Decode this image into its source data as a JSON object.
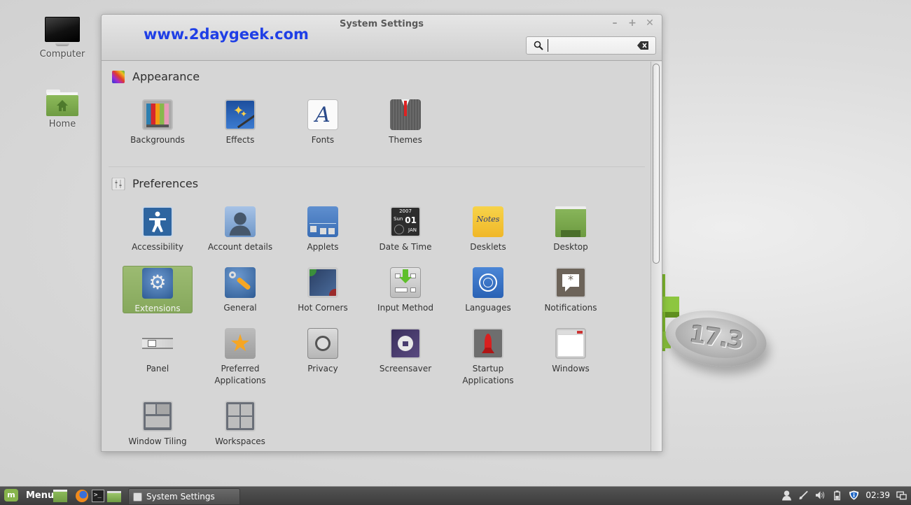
{
  "desktop": {
    "icons": [
      {
        "label": "Computer",
        "icon": "computer-icon"
      },
      {
        "label": "Home",
        "icon": "home-folder-icon"
      }
    ],
    "wallpaper_badge": "17.3"
  },
  "window": {
    "title": "System Settings",
    "watermark": "www.2daygeek.com",
    "controls": {
      "minimize": "–",
      "maximize": "+",
      "close": "✕"
    },
    "search": {
      "value": "",
      "placeholder": ""
    }
  },
  "sections": [
    {
      "title": "Appearance",
      "icon": "appearance-icon",
      "items": [
        {
          "label": "Backgrounds",
          "icon": "backgrounds-icon"
        },
        {
          "label": "Effects",
          "icon": "effects-icon"
        },
        {
          "label": "Fonts",
          "icon": "fonts-icon"
        },
        {
          "label": "Themes",
          "icon": "themes-icon"
        }
      ]
    },
    {
      "title": "Preferences",
      "icon": "preferences-icon",
      "items": [
        {
          "label": "Accessibility",
          "icon": "accessibility-icon"
        },
        {
          "label": "Account details",
          "icon": "account-details-icon"
        },
        {
          "label": "Applets",
          "icon": "applets-icon"
        },
        {
          "label": "Date & Time",
          "icon": "date-time-icon",
          "detail": {
            "year": "2007",
            "day": "Sun",
            "date": "01",
            "month": "JAN"
          }
        },
        {
          "label": "Desklets",
          "icon": "desklets-icon",
          "detail": {
            "text": "Notes"
          }
        },
        {
          "label": "Desktop",
          "icon": "desktop-icon"
        },
        {
          "label": "Extensions",
          "icon": "extensions-icon",
          "selected": true
        },
        {
          "label": "General",
          "icon": "general-icon"
        },
        {
          "label": "Hot Corners",
          "icon": "hot-corners-icon"
        },
        {
          "label": "Input Method",
          "icon": "input-method-icon"
        },
        {
          "label": "Languages",
          "icon": "languages-icon"
        },
        {
          "label": "Notifications",
          "icon": "notifications-icon"
        },
        {
          "label": "Panel",
          "icon": "panel-icon"
        },
        {
          "label": "Preferred Applications",
          "icon": "preferred-applications-icon"
        },
        {
          "label": "Privacy",
          "icon": "privacy-icon"
        },
        {
          "label": "Screensaver",
          "icon": "screensaver-icon"
        },
        {
          "label": "Startup Applications",
          "icon": "startup-applications-icon"
        },
        {
          "label": "Windows",
          "icon": "windows-icon"
        },
        {
          "label": "Window Tiling",
          "icon": "window-tiling-icon"
        },
        {
          "label": "Workspaces",
          "icon": "workspaces-icon"
        }
      ]
    }
  ],
  "taskbar": {
    "menu_label": "Menu",
    "launchers": [
      "show-desktop-icon",
      "firefox-icon",
      "terminal-icon",
      "files-icon"
    ],
    "tasks": [
      {
        "label": "System Settings"
      }
    ],
    "tray": [
      "user-icon",
      "network-icon",
      "volume-icon",
      "battery-icon",
      "update-shield-icon"
    ],
    "clock": "02:39"
  },
  "colors": {
    "accent_selected": "#8fb266",
    "watermark": "#1f3fe6",
    "mint_green": "#87b44c"
  }
}
